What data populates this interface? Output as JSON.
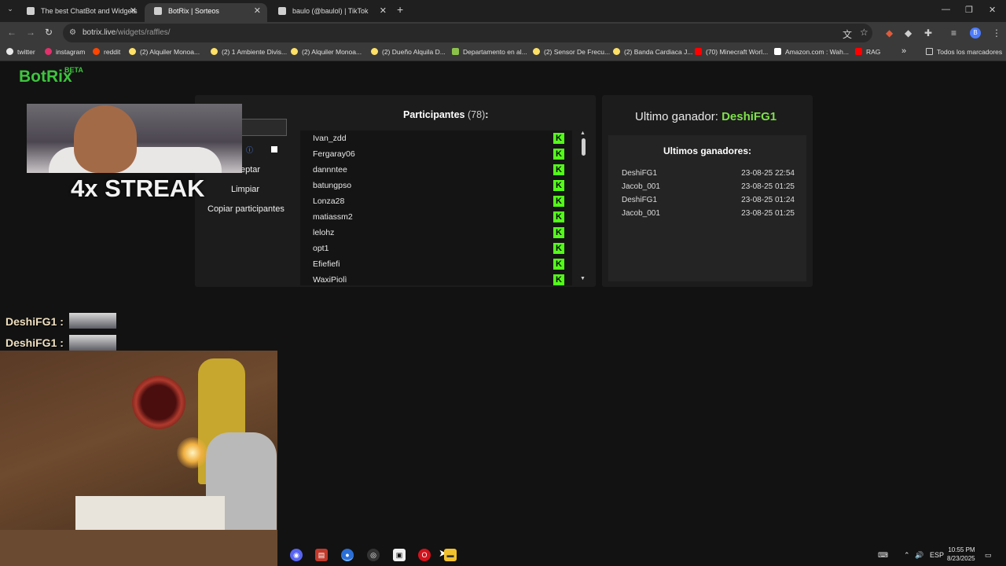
{
  "browser": {
    "tabs": [
      {
        "title": "The best ChatBot and Widgets",
        "active": false
      },
      {
        "title": "BotRix | Sorteos",
        "active": true
      },
      {
        "title": "baulo (@baulol) | TikTok",
        "active": false
      }
    ],
    "tab_close": "✕",
    "new_tab": "+",
    "tab_list": "⌄",
    "window_controls": [
      "—",
      "❐",
      "✕"
    ],
    "nav": {
      "back": "←",
      "forward": "→",
      "reload": "↻"
    },
    "url_host": "botrix.live",
    "url_path": "/widgets/raffles/",
    "toolbar_icons": [
      "translate-icon",
      "star-icon",
      "extension-icon",
      "extension-icon",
      "puzzle-icon",
      "media-icon"
    ],
    "profile_initial": "B",
    "menu": "⋮",
    "bookmarks": [
      {
        "label": "twitter",
        "color": "#e8e8e8"
      },
      {
        "label": "instagram",
        "color": "#e1306c"
      },
      {
        "label": "reddit",
        "color": "#ff4500"
      },
      {
        "label": "(2) Alquiler Monoa...",
        "color": "#ffe066"
      },
      {
        "label": "(2) 1 Ambiente Divis...",
        "color": "#ffe066"
      },
      {
        "label": "(2) Alquiler Monoa...",
        "color": "#ffe066"
      },
      {
        "label": "(2) Dueño Alquila D...",
        "color": "#ffe066"
      },
      {
        "label": "Departamento en al...",
        "color": "#8bc34a"
      },
      {
        "label": "(2) Sensor De Frecu...",
        "color": "#ffe066"
      },
      {
        "label": "(2) Banda Cardiaca J...",
        "color": "#ffe066"
      },
      {
        "label": "(70) Minecraft Worl...",
        "color": "#ff0000"
      },
      {
        "label": "Amazon.com : Wah...",
        "color": "#ffffff"
      },
      {
        "label": "RAG",
        "color": "#ff0000"
      }
    ],
    "bookmarks_more": "»",
    "all_bookmarks": "Todos los marcadores"
  },
  "page": {
    "logo": "BotRix",
    "logo_badge": "BETA",
    "brand_color": "#3ec43e",
    "buttons": {
      "accept_partial": "eptar",
      "clear": "Limpiar",
      "copy": "Copiar participantes"
    },
    "participants_label": "Participantes",
    "participants_count": "(78)",
    "participants_suffix": ":",
    "participants": [
      "Ivan_zdd",
      "Fergaray06",
      "dannntee",
      "batungpso",
      "Lonza28",
      "matiassm2",
      "lelohz",
      "opt1",
      "Efiefiefi",
      "WaxiPiolì"
    ],
    "platform_icon_letter": "K",
    "last_winner_label": "Ultimo ganador:",
    "last_winner_name": "DeshiFG1",
    "winners_heading": "Ultimos ganadores:",
    "winners": [
      {
        "name": "DeshiFG1",
        "date": "23-08-25 22:54"
      },
      {
        "name": "Jacob_001",
        "date": "23-08-25 01:25"
      },
      {
        "name": "DeshiFG1",
        "date": "23-08-25 01:24"
      },
      {
        "name": "Jacob_001",
        "date": "23-08-25 01:25"
      }
    ]
  },
  "overlay": {
    "streak": "4x STREAK",
    "chat": [
      {
        "user": "DeshiFG1 :"
      },
      {
        "user": "DeshiFG1 :"
      }
    ]
  },
  "taskbar": {
    "apps": [
      "discord-icon",
      "voicemeeter-icon",
      "chrome-icon",
      "obs-icon",
      "app-icon",
      "opera-icon",
      "explorer-icon"
    ],
    "lang": "ESP",
    "time": "10:55 PM",
    "date": "8/23/2025"
  }
}
